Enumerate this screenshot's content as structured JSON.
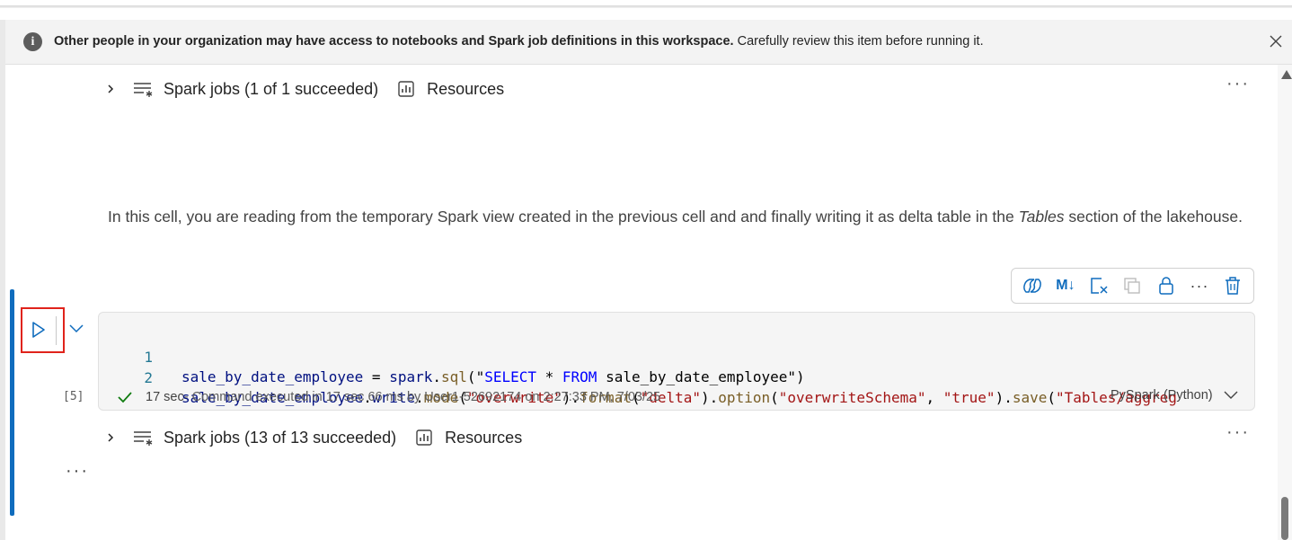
{
  "banner": {
    "bold_text": "Other people in your organization may have access to notebooks and Spark job definitions in this workspace.",
    "text": " Carefully review this item before running it.",
    "info_icon": "i",
    "close_icon": "close-icon"
  },
  "previous_cell": {
    "spark_jobs_label": "Spark jobs (1 of 1 succeeded)",
    "resources_label": "Resources",
    "more_label": "···"
  },
  "markdown_cell": {
    "text_before": "In this cell, you are reading from the temporary Spark view created in the previous cell and and finally writing it as delta table in the ",
    "text_italic": "Tables",
    "text_after": " section of the lakehouse."
  },
  "cell_toolbar": {
    "items": [
      "copilot-icon",
      "markdown-toggle-icon",
      "clear-output-icon",
      "copy-icon",
      "lock-icon",
      "more-icon",
      "delete-icon"
    ],
    "ml_label": "M↓",
    "more_label": "···"
  },
  "code_cell": {
    "execution_count": "[5]",
    "lines": [
      {
        "number": "1",
        "tokens": {
          "t1": "sale_by_date_employee",
          "t2": " = ",
          "t3": "spark",
          "t4": ".",
          "t5": "sql",
          "t6": "(",
          "t7": "\"",
          "t8": "SELECT",
          "t9": " * ",
          "t10": "FROM",
          "t11": " sale_by_date_employee\"",
          "t12": ")"
        }
      },
      {
        "number": "2",
        "tokens": {
          "t1": "sale_by_date_employee",
          "t2": ".",
          "t3": "write",
          "t4": ".",
          "t5": "mode",
          "t6": "(",
          "t7": "\"overwrite\"",
          "t8": ").",
          "t9": "format",
          "t10": "(",
          "t11": "\"delta\"",
          "t12": ").",
          "t13": "option",
          "t14": "(",
          "t15": "\"overwriteSchema\"",
          "t16": ", ",
          "t17": "\"true\"",
          "t18": ").",
          "t19": "save",
          "t20": "(",
          "t21": "\"Tables/aggreg"
        }
      }
    ],
    "status_duration": "17 sec",
    "status_text": " - Command executed in 17 sec 66 ms by User1-52692174 on 2:27:33 PM, 7/03/25",
    "language": "PySpark (Python)",
    "more_label": "···"
  },
  "output": {
    "spark_jobs_label": "Spark jobs (13 of 13 succeeded)",
    "resources_label": "Resources",
    "more_label": "···"
  },
  "colors": {
    "accent": "#0f6cbd",
    "highlight_box": "#e0231b",
    "success": "#107c10"
  }
}
